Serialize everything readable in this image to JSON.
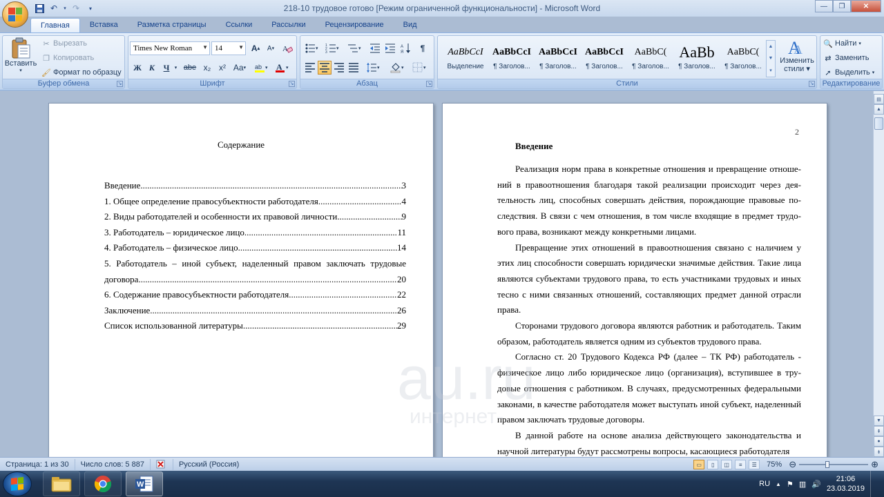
{
  "window": {
    "title": "218-10 трудовое готово  [Режим ограниченной функциональности] - Microsoft Word",
    "controls": [
      "—",
      "❐",
      "✕"
    ]
  },
  "tabs": [
    "Главная",
    "Вставка",
    "Разметка страницы",
    "Ссылки",
    "Рассылки",
    "Рецензирование",
    "Вид"
  ],
  "ribbon": {
    "clipboard": {
      "label": "Буфер обмена",
      "paste": "Вставить",
      "cut": "Вырезать",
      "copy": "Копировать",
      "format_painter": "Формат по образцу"
    },
    "font": {
      "label": "Шрифт",
      "name": "Times New Roman",
      "size": "14",
      "bold": "Ж",
      "italic": "К",
      "underline": "Ч",
      "strike": "abe",
      "subscript": "x₂",
      "superscript": "x²",
      "case": "Aa",
      "grow": "A",
      "shrink": "A"
    },
    "paragraph": {
      "label": "Абзац"
    },
    "styles": {
      "label": "Стили",
      "items": [
        {
          "sample": "AaBbCcI",
          "name": "Выделение"
        },
        {
          "sample": "AaBbCcI",
          "name": "¶ Заголов..."
        },
        {
          "sample": "AaBbCcI",
          "name": "¶ Заголов..."
        },
        {
          "sample": "AaBbCcI",
          "name": "¶ Заголов..."
        },
        {
          "sample": "AaBbC(",
          "name": "¶ Заголов..."
        },
        {
          "sample": "AaBb",
          "name": "¶ Заголов..."
        },
        {
          "sample": "AaBbC(",
          "name": "¶ Заголов..."
        }
      ],
      "change_styles_line1": "Изменить",
      "change_styles_line2": "стили"
    },
    "editing": {
      "label": "Редактирование",
      "find": "Найти",
      "replace": "Заменить",
      "select": "Выделить"
    }
  },
  "page1": {
    "toc_title": "Содержание",
    "entries": [
      {
        "text": "Введение",
        "page": "3"
      },
      {
        "text": "1. Общее определение правосубъектности работодателя",
        "page": "4"
      },
      {
        "text": "2. Виды работодателей и особенности их правовой личности",
        "page": "9"
      },
      {
        "text": "3.  Работодатель – юридическое лицо",
        "page": "11"
      },
      {
        "text": "4. Работодатель – физическое лицо",
        "page": "14"
      },
      {
        "text": "5. Работодатель – иной субъект, наделенный правом заключать трудовые",
        "text2": "договора.",
        "page": "20"
      },
      {
        "text": "6. Содержание правосубъектности работодателя.",
        "page": "22"
      },
      {
        "text": "Заключение",
        "page": "26"
      },
      {
        "text": "Список использованной литературы",
        "page": "29"
      }
    ]
  },
  "page2": {
    "page_number": "2",
    "heading": "Введение",
    "paragraphs": [
      "Реализация норм права в конкретные отношения и превращение отноше­ний в правоотношения благодаря такой реализации происходит через дея­тельность лиц, способных совершать действия, порождающие правовые по­следствия. В связи с чем отношения, в том числе входящие в предмет трудо­вого права, возникают между конкретными лицами.",
      "Превращение этих отношений в правоотношения связано с наличием у этих лиц способности совершать юридически значимые действия. Такие лица являются субъектами трудового права, то есть участниками трудовых и иных тесно с ними связанных отношений, составляющих предмет данной отрасли права.",
      "Сторонами трудового договора являются работник и работодатель. Та­ким образом, работодатель является одним из субъектов трудового права.",
      "Согласно ст. 20 Трудового Кодекса РФ (далее – ТК РФ) работодатель - физическое лицо либо юридическое лицо (организация), вступившее в тру­довые отношения с работником. В случаях, предусмотренных федеральными законами, в качестве работодателя может выступать иной субъект, наделен­ный правом заключать трудовые договоры.",
      "В данной работе на основе анализа действующего законодательства и научной литературы будут рассмотрены вопросы, касающиеся работодателя"
    ]
  },
  "watermark": {
    "line1": "au.ru",
    "line2": "интернет-"
  },
  "statusbar": {
    "page": "Страница: 1 из 30",
    "words": "Число слов: 5 887",
    "language": "Русский (Россия)",
    "zoom": "75%",
    "zoom_fraction": 0.4
  },
  "taskbar": {
    "lang": "RU",
    "time": "21:06",
    "date": "23.03.2019"
  }
}
